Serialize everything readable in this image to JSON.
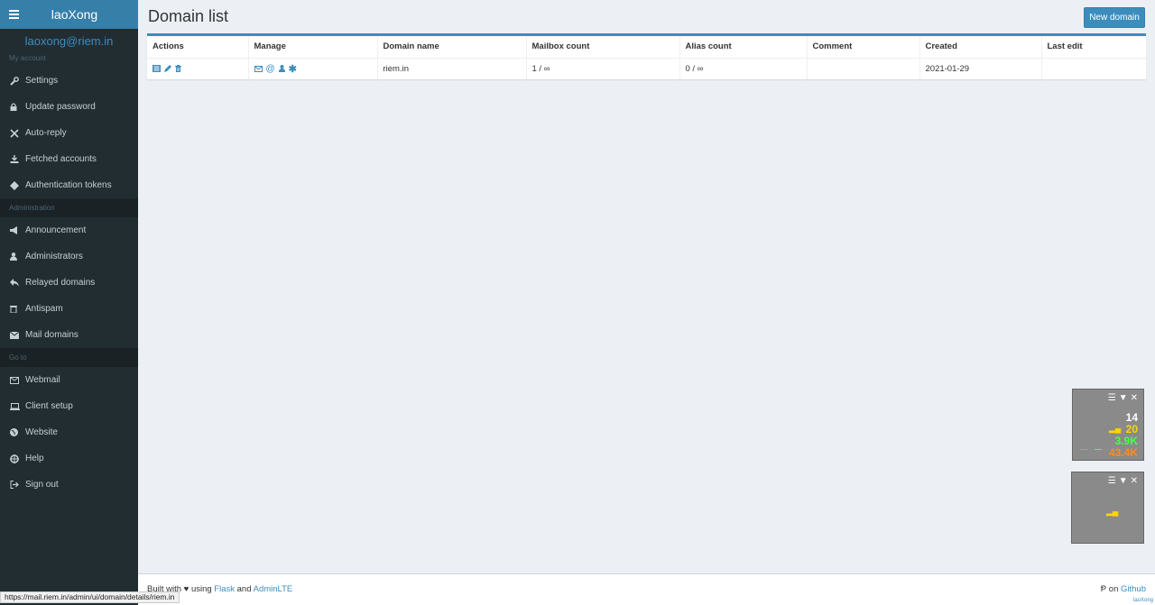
{
  "brand": "laoXong",
  "user_email": "laoxong@riem.in",
  "sections": {
    "my_account": "My account",
    "administration": "Administration",
    "go_to": "Go to"
  },
  "nav_my_account": [
    {
      "label": "Settings",
      "icon": "wrench-icon"
    },
    {
      "label": "Update password",
      "icon": "lock-icon"
    },
    {
      "label": "Auto-reply",
      "icon": "plane-icon"
    },
    {
      "label": "Fetched accounts",
      "icon": "download-icon"
    },
    {
      "label": "Authentication tokens",
      "icon": "ticket-icon"
    }
  ],
  "nav_admin": [
    {
      "label": "Announcement",
      "icon": "bullhorn-icon"
    },
    {
      "label": "Administrators",
      "icon": "user-icon"
    },
    {
      "label": "Relayed domains",
      "icon": "reply-icon"
    },
    {
      "label": "Antispam",
      "icon": "trash-icon"
    },
    {
      "label": "Mail domains",
      "icon": "envelope-icon"
    }
  ],
  "nav_goto": [
    {
      "label": "Webmail",
      "icon": "envelope-outline-icon"
    },
    {
      "label": "Client setup",
      "icon": "laptop-icon"
    },
    {
      "label": "Website",
      "icon": "globe-icon"
    },
    {
      "label": "Help",
      "icon": "lifebuoy-icon"
    },
    {
      "label": "Sign out",
      "icon": "sign-out-icon"
    }
  ],
  "page_title": "Domain list",
  "new_domain_label": "New domain",
  "table": {
    "headers": [
      "Actions",
      "Manage",
      "Domain name",
      "Mailbox count",
      "Alias count",
      "Comment",
      "Created",
      "Last edit"
    ],
    "rows": [
      {
        "domain": "riem.in",
        "mailbox_count": "1 / ∞",
        "alias_count": "0 / ∞",
        "comment": "",
        "created": "2021-01-29",
        "last_edit": ""
      }
    ]
  },
  "widget1": {
    "v1": "14",
    "v2": "20",
    "v3": "3.9K",
    "v4": "43.4K"
  },
  "footer": {
    "built_with": "Built with",
    "using": "using",
    "flask": "Flask",
    "and": "and",
    "adminlte": "AdminLTE",
    "on": "on",
    "github": "Github"
  },
  "status_url": "https://mail.riem.in/admin/ui/domain/details/riem.in",
  "corner_tag": "laoXong",
  "colors": {
    "accent": "#3c8dbc",
    "sidebar_bg": "#222d32",
    "brand_bg": "#367fa9"
  }
}
